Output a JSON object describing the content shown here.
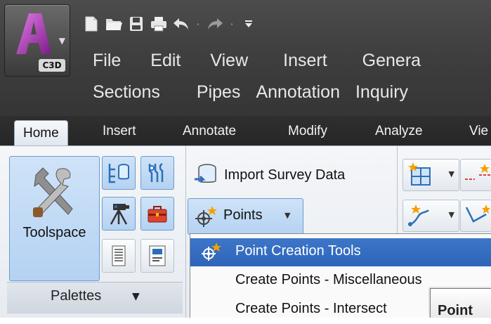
{
  "app": {
    "badge": "C3D"
  },
  "quick_access": {
    "icons": [
      "new-file-icon",
      "open-folder-icon",
      "save-icon",
      "print-icon",
      "undo-icon",
      "redo-icon",
      "qat-customize-icon"
    ]
  },
  "menubar": {
    "row1": [
      "File",
      "Edit",
      "View",
      "Insert",
      "Genera"
    ],
    "row2": [
      "Sections",
      "Pipes",
      "Annotation",
      "Inquiry"
    ]
  },
  "ribbon_tabs": [
    "Home",
    "Insert",
    "Annotate",
    "Modify",
    "Analyze",
    "Vie"
  ],
  "active_tab": "Home",
  "palettes_panel": {
    "toolspace_label": "Toolspace",
    "panel_label": "Palettes"
  },
  "create_ground_data": {
    "import_label": "Import Survey Data",
    "points_label": "Points"
  },
  "points_menu": {
    "items": [
      "Point Creation Tools",
      "Create Points - Miscellaneous",
      "Create Points - Intersect"
    ],
    "highlighted_index": 0
  },
  "tooltip": {
    "text": "Point"
  },
  "colors": {
    "highlight": "#2d64b8",
    "button_highlight": "#b4d2f2",
    "title_bar": "#3e3e3e"
  }
}
